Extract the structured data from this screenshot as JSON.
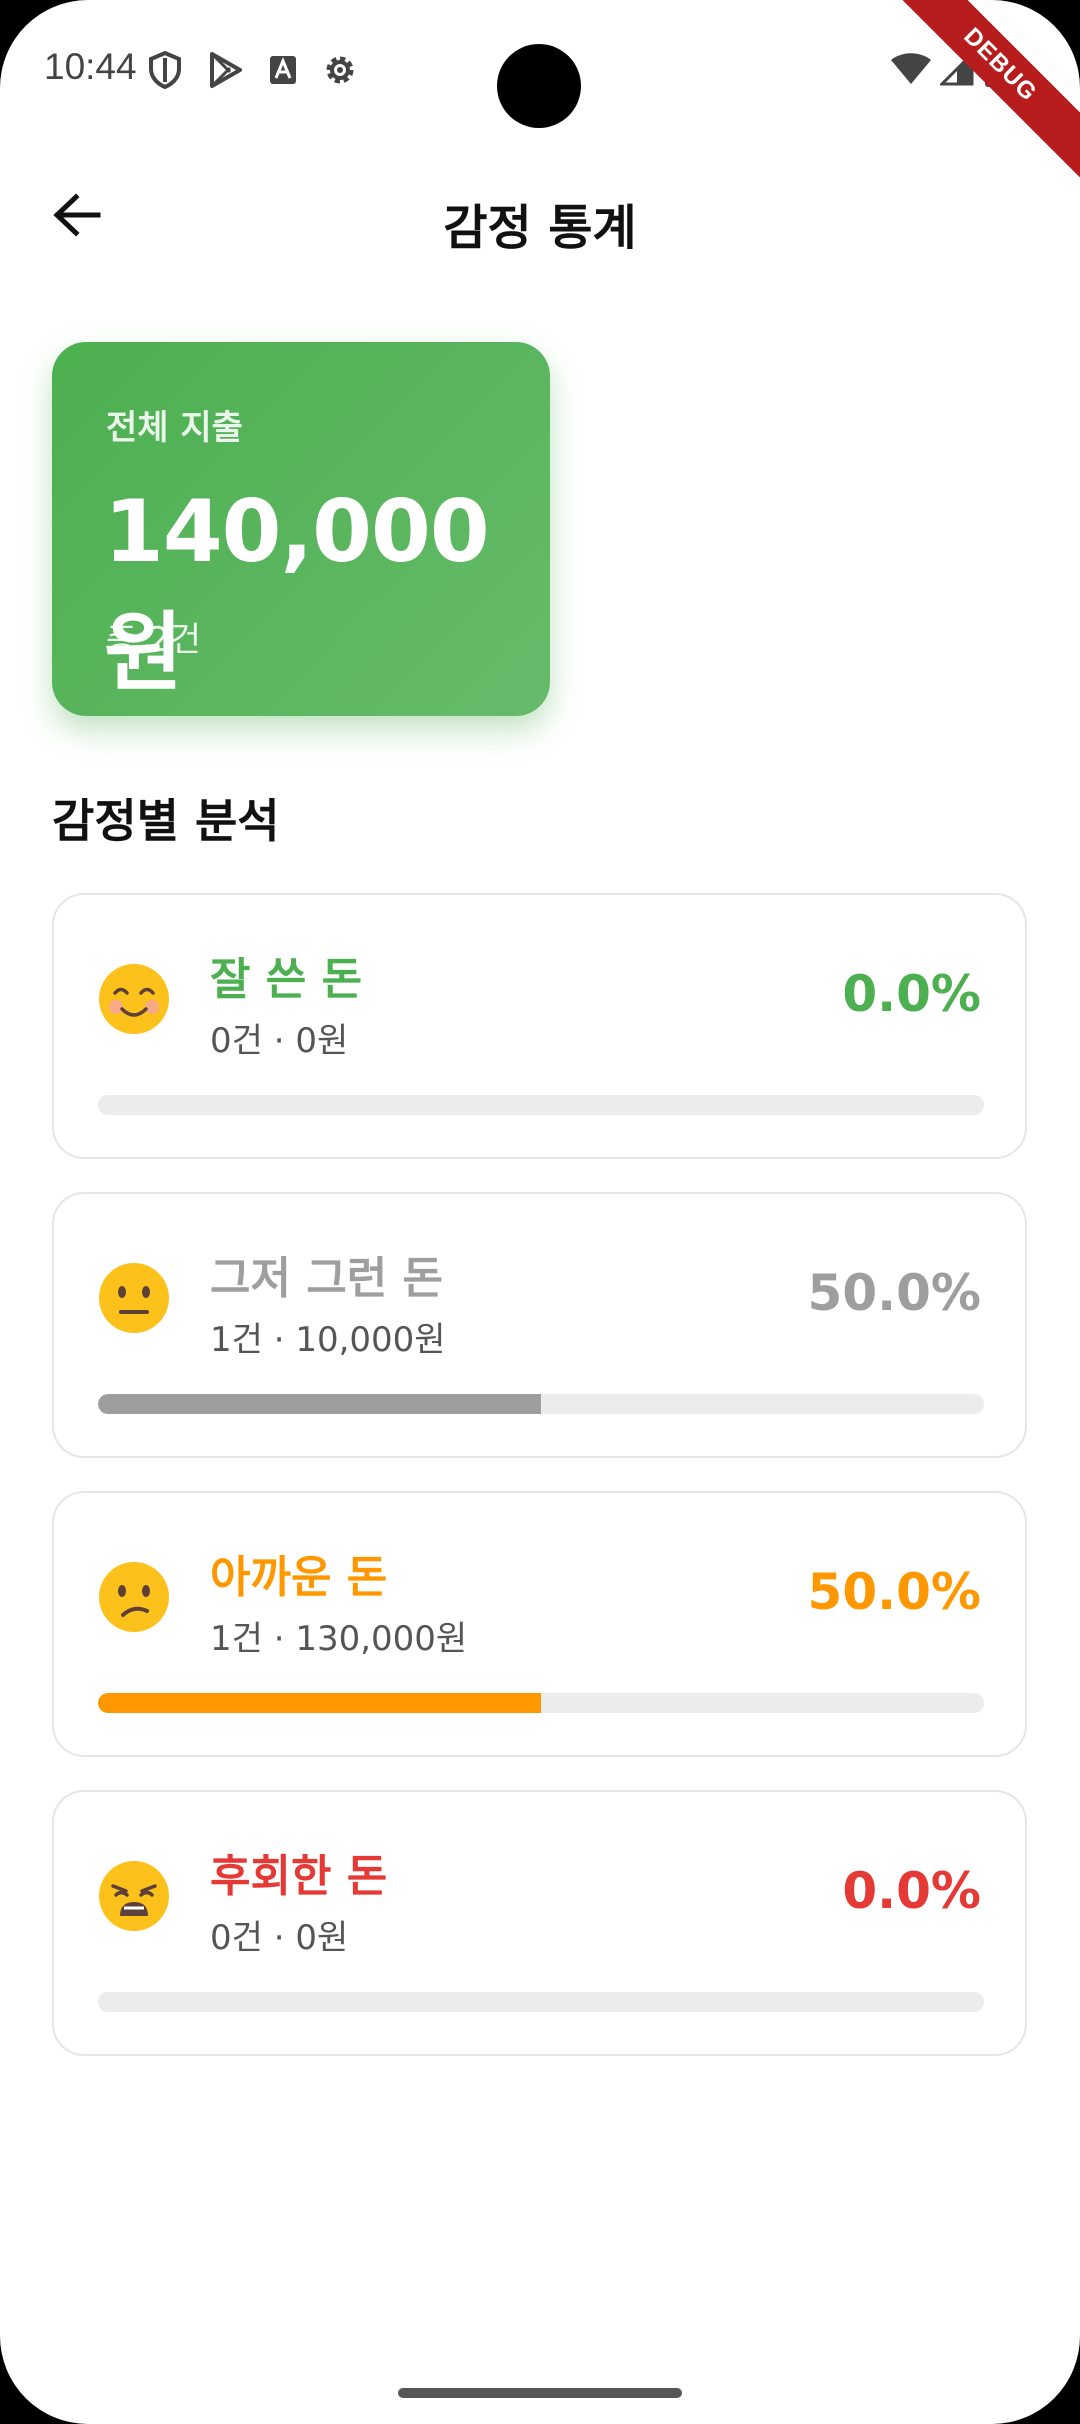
{
  "status_bar": {
    "time": "10:44",
    "icons": [
      "shield-icon",
      "play-store-icon",
      "font-icon",
      "gear-icon",
      "wifi-icon",
      "signal-icon",
      "battery-icon"
    ]
  },
  "debug_banner": "DEBUG",
  "app_bar": {
    "back_icon": "arrow-left-icon",
    "title": "감정 통계"
  },
  "summary": {
    "label": "전체 지출",
    "amount": "140,000원",
    "count": "총 2건",
    "color": "#4caf50"
  },
  "section_title": "감정별 분석",
  "emotions": [
    {
      "emoji": "smiling-face-icon",
      "name": "잘 쓴 돈",
      "meta": "0건 · 0원",
      "percent_label": "0.0%",
      "percent": 0.0,
      "color": "#4caf50"
    },
    {
      "emoji": "neutral-face-icon",
      "name": "그저 그런 돈",
      "meta": "1건 · 10,000원",
      "percent_label": "50.0%",
      "percent": 50.0,
      "color": "#9e9e9e"
    },
    {
      "emoji": "confused-face-icon",
      "name": "아까운 돈",
      "meta": "1건 · 130,000원",
      "percent_label": "50.0%",
      "percent": 50.0,
      "color": "#ff9800"
    },
    {
      "emoji": "weary-face-icon",
      "name": "후회한 돈",
      "meta": "0건 · 0원",
      "percent_label": "0.0%",
      "percent": 0.0,
      "color": "#e53935"
    }
  ]
}
